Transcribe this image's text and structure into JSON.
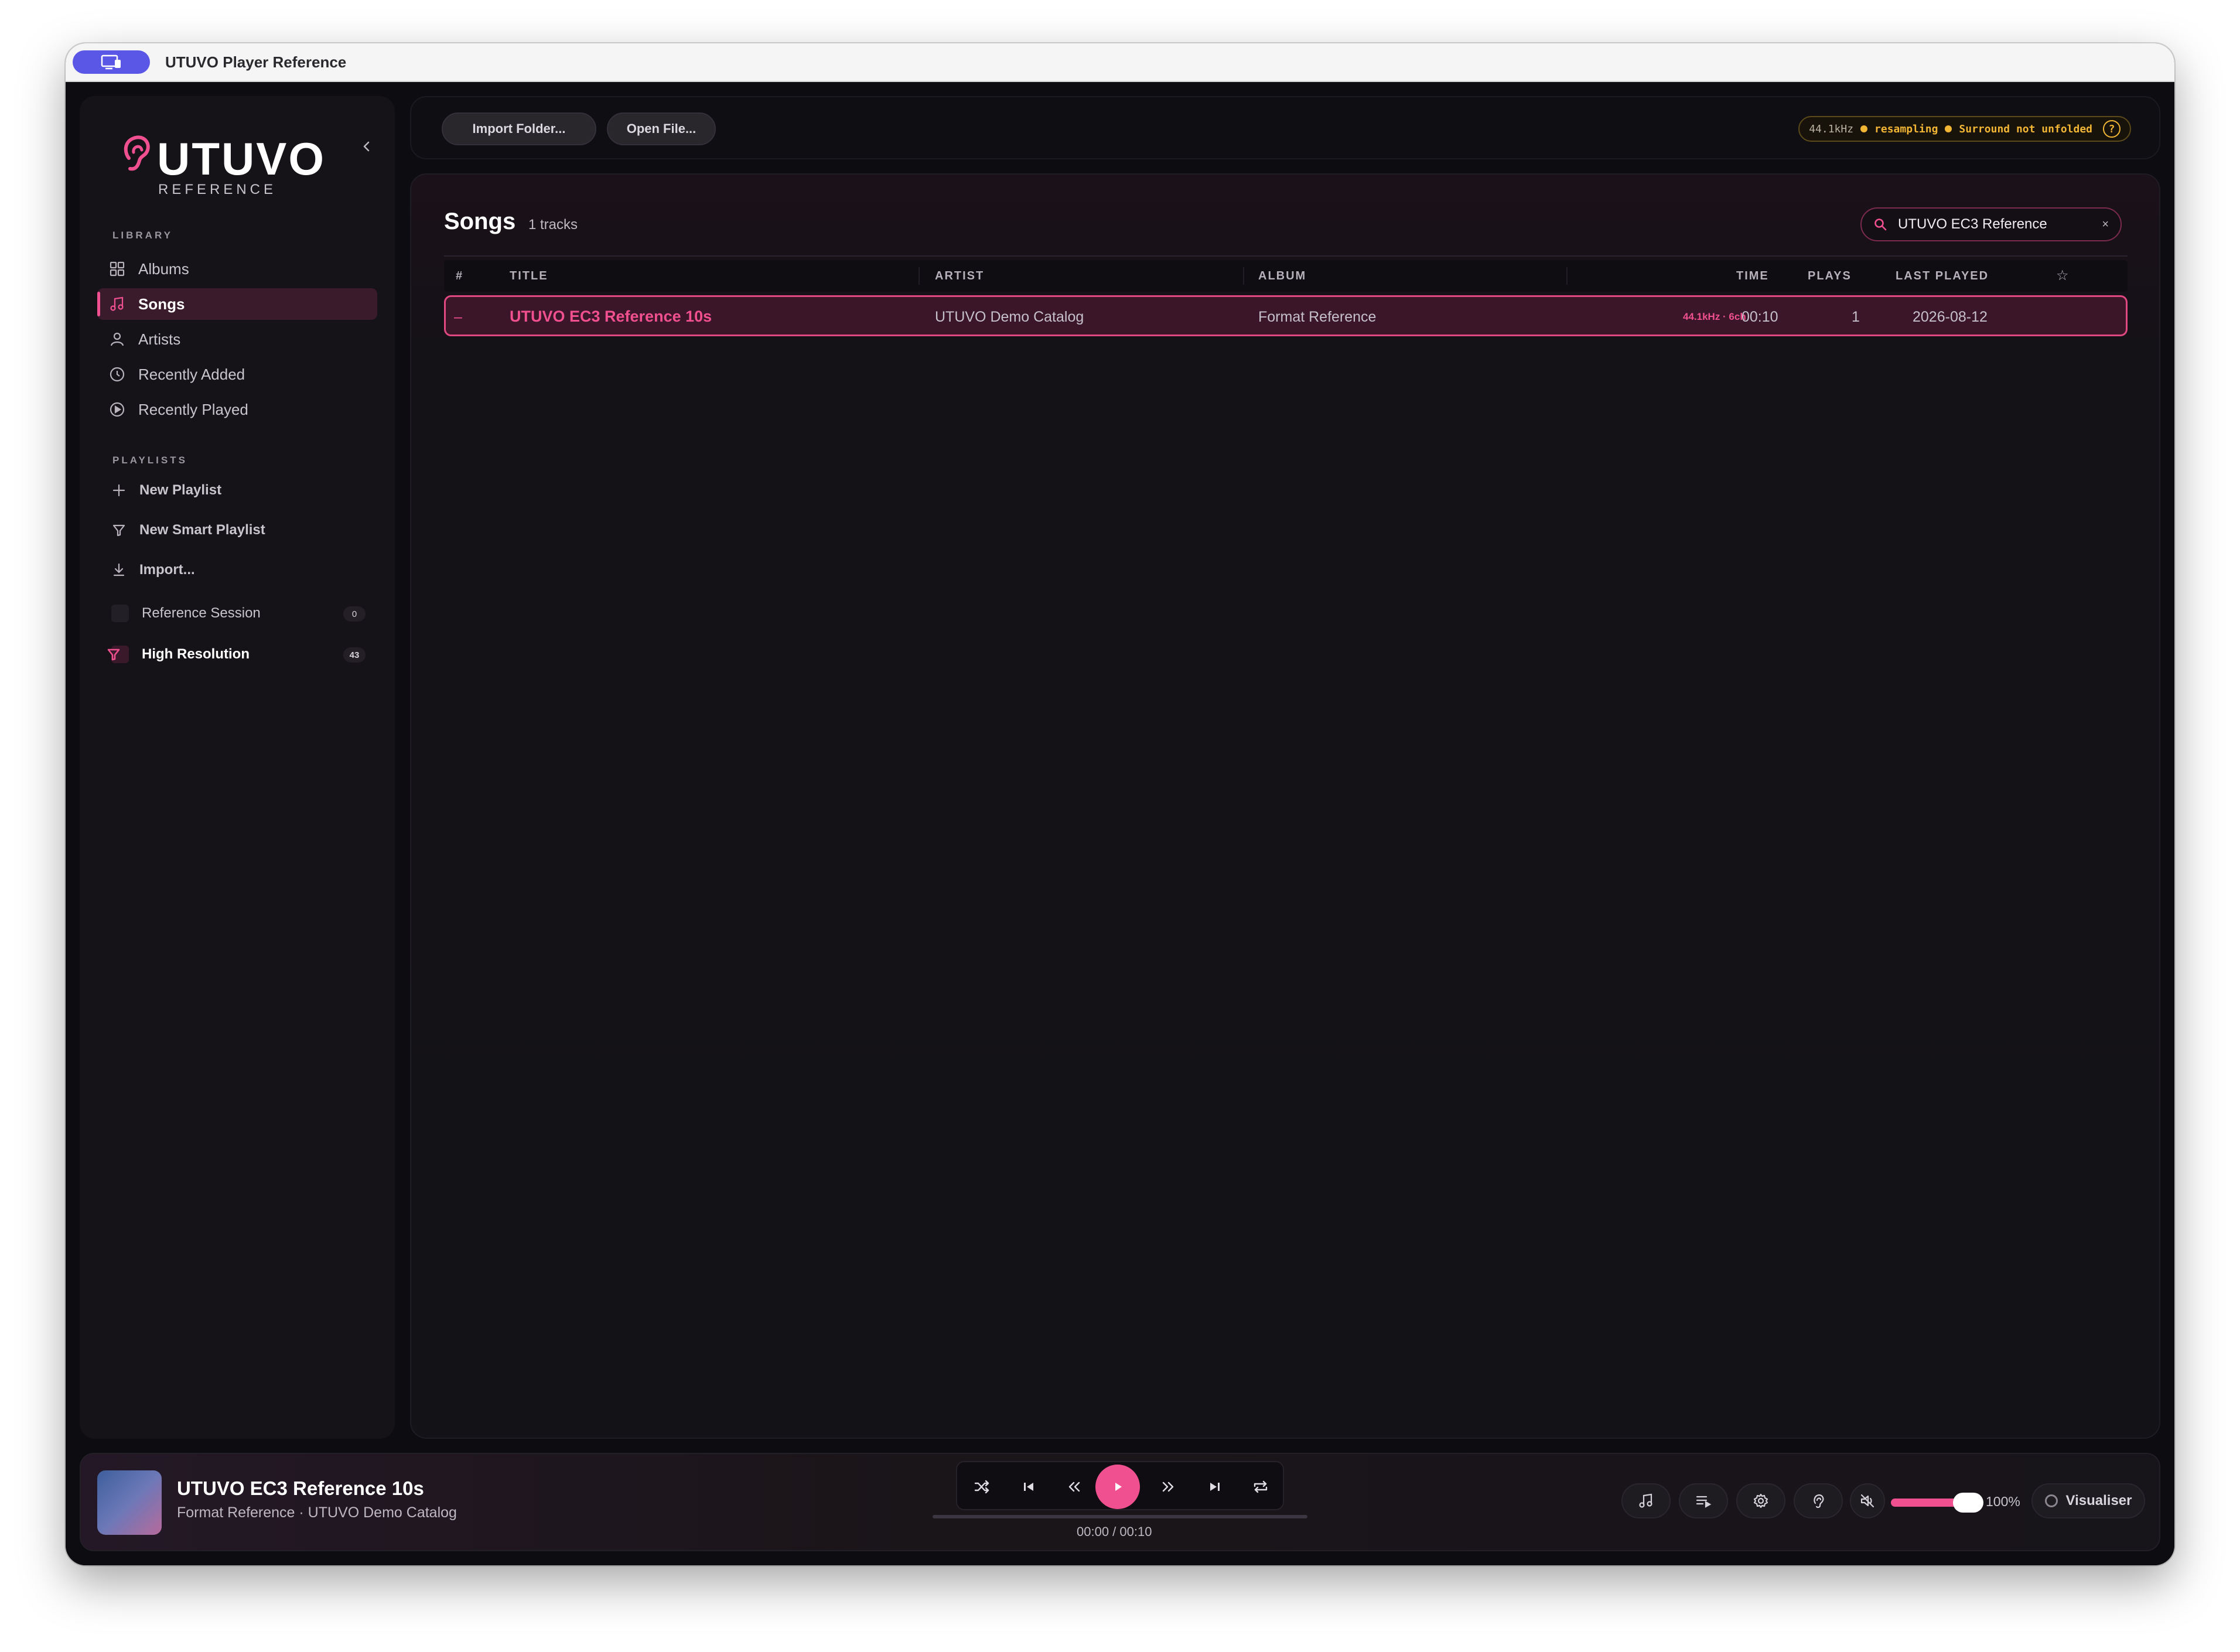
{
  "window": {
    "title": "UTUVO Player Reference"
  },
  "sidebar": {
    "logo": "UTUVO",
    "logo_sub": "REFERENCE",
    "library_title": "LIBRARY",
    "library_items": [
      {
        "label": "Albums",
        "icon": "grid-icon"
      },
      {
        "label": "Songs",
        "icon": "music-note-icon",
        "active": true
      },
      {
        "label": "Artists",
        "icon": "person-icon"
      },
      {
        "label": "Recently Added",
        "icon": "clock-icon"
      },
      {
        "label": "Recently Played",
        "icon": "play-circle-icon"
      }
    ],
    "playlists_title": "PLAYLISTS",
    "playlist_actions": [
      {
        "label": "New Playlist",
        "icon": "plus-icon"
      },
      {
        "label": "New Smart Playlist",
        "icon": "filter-icon"
      },
      {
        "label": "Import...",
        "icon": "download-icon"
      }
    ],
    "playlists": [
      {
        "label": "Reference Session",
        "count": "0"
      },
      {
        "label": "High Resolution",
        "count": "43",
        "smart": true
      }
    ]
  },
  "toolbar": {
    "import_folder": "Import Folder...",
    "open_file": "Open File...",
    "status": {
      "rate": "44.1kHz",
      "resampling": "resampling",
      "surround": "Surround not unfolded",
      "help": "?"
    }
  },
  "songs": {
    "title": "Songs",
    "count": "1 tracks",
    "search_value": "UTUVO EC3 Reference",
    "search_clear": "×",
    "columns": {
      "num": "#",
      "title": "TITLE",
      "artist": "ARTIST",
      "album": "ALBUM",
      "time": "TIME",
      "plays": "PLAYS",
      "last_played": "LAST PLAYED",
      "star": "☆"
    },
    "rows": [
      {
        "num": "–",
        "title": "UTUVO EC3 Reference 10s",
        "artist": "UTUVO Demo Catalog",
        "album": "Format Reference",
        "format": "44.1kHz · 6ch",
        "time": "00:10",
        "plays": "1",
        "last_played": "2026-08-12"
      }
    ]
  },
  "player": {
    "title": "UTUVO EC3 Reference 10s",
    "subtitle": "Format Reference · UTUVO Demo Catalog",
    "time": "00:00 / 00:10",
    "progress": 0,
    "volume_label": "100%",
    "volume": 1.0,
    "visualiser": "Visualiser"
  },
  "colors": {
    "accent": "#f0508f",
    "warning": "#f2b634",
    "background": "#0d0c10"
  }
}
